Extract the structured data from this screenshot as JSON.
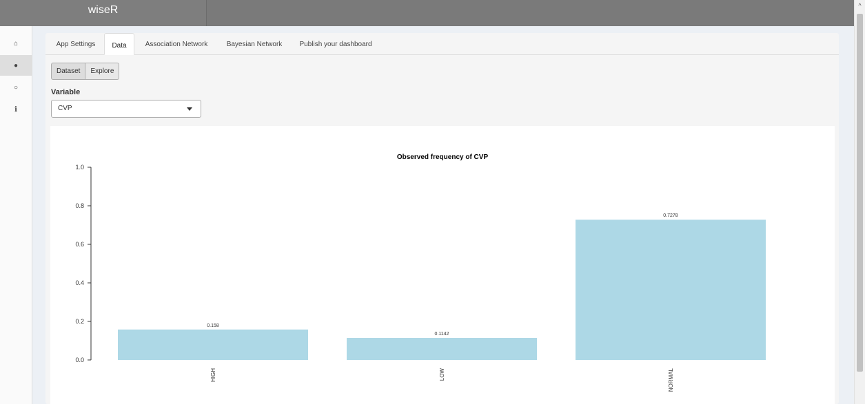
{
  "app": {
    "title": "wiseR"
  },
  "sidebar": {
    "items": [
      {
        "icon": "home-icon",
        "glyph": "⌂"
      },
      {
        "icon": "globe-icon",
        "glyph": "●"
      },
      {
        "icon": "github-icon",
        "glyph": "○"
      },
      {
        "icon": "info-icon",
        "glyph": "i"
      }
    ]
  },
  "tabs": [
    {
      "label": "App Settings"
    },
    {
      "label": "Data"
    },
    {
      "label": "Association Network"
    },
    {
      "label": "Bayesian Network"
    },
    {
      "label": "Publish your dashboard"
    }
  ],
  "active_tab": "Data",
  "buttons": {
    "dataset": "Dataset",
    "explore": "Explore"
  },
  "variable": {
    "label": "Variable",
    "value": "CVP"
  },
  "chart_data": {
    "type": "bar",
    "title": "Observed frequency of  CVP",
    "categories": [
      "HIGH",
      "LOW",
      "NORMAL"
    ],
    "values": [
      0.158,
      0.1142,
      0.7278
    ],
    "data_labels": [
      "0.158",
      "0.1142",
      "0.7278"
    ],
    "ylim": [
      0,
      1.0
    ],
    "yticks": [
      "0.0",
      "0.2",
      "0.4",
      "0.6",
      "0.8",
      "1.0"
    ],
    "bar_color": "#add8e6",
    "grid": false
  }
}
